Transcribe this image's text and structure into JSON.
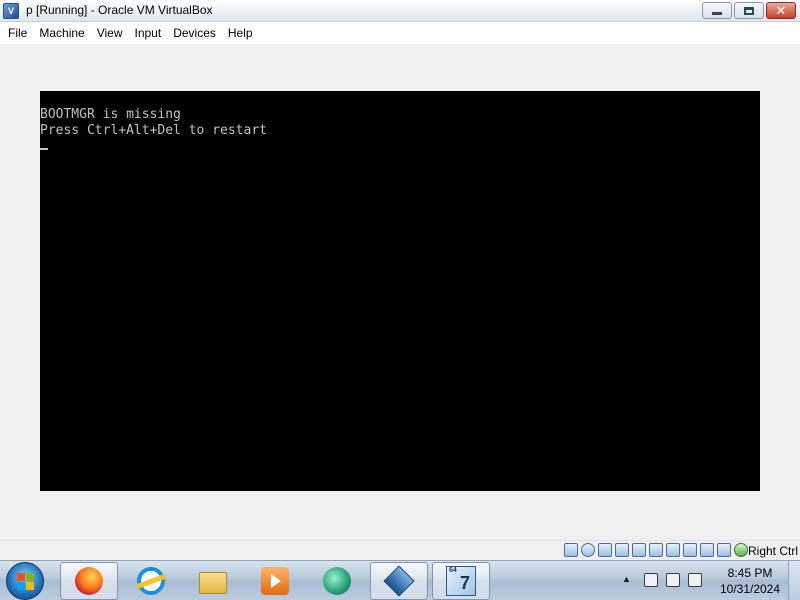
{
  "window": {
    "title": "p [Running] - Oracle VM VirtualBox",
    "controls": {
      "minimize_icon": "minimize-icon",
      "maximize_icon": "restore-icon",
      "close_label": "✕"
    }
  },
  "menubar": {
    "items": [
      {
        "label": "File"
      },
      {
        "label": "Machine"
      },
      {
        "label": "View"
      },
      {
        "label": "Input"
      },
      {
        "label": "Devices"
      },
      {
        "label": "Help"
      }
    ]
  },
  "vm_console": {
    "lines": [
      "BOOTMGR is missing",
      "Press Ctrl+Alt+Del to restart"
    ],
    "text_color": "#c0c0c0",
    "background": "#000000"
  },
  "vm_statusbar": {
    "indicators": [
      "hard-disk-icon",
      "optical-drive-icon",
      "audio-icon",
      "network-icon",
      "usb-icon",
      "shared-folders-icon",
      "display-icon",
      "recording-icon",
      "virtualization-icon",
      "cpu-icon",
      "mouse-integration-icon"
    ],
    "host_key": "Right Ctrl"
  },
  "taskbar": {
    "apps": [
      {
        "name": "firefox-icon",
        "active": true
      },
      {
        "name": "internet-explorer-icon",
        "active": false
      },
      {
        "name": "windows-explorer-icon",
        "active": false
      },
      {
        "name": "media-player-icon",
        "active": false
      },
      {
        "name": "green-app-icon",
        "active": false
      },
      {
        "name": "virtualbox-icon",
        "active": true
      },
      {
        "name": "vm-windows7-icon",
        "active": true
      }
    ],
    "tray": {
      "icons": [
        "show-hidden-icons-arrow",
        "network-tray-icon",
        "action-center-flag-icon",
        "volume-icon"
      ],
      "time": "8:45 PM",
      "date": "10/31/2024"
    }
  }
}
